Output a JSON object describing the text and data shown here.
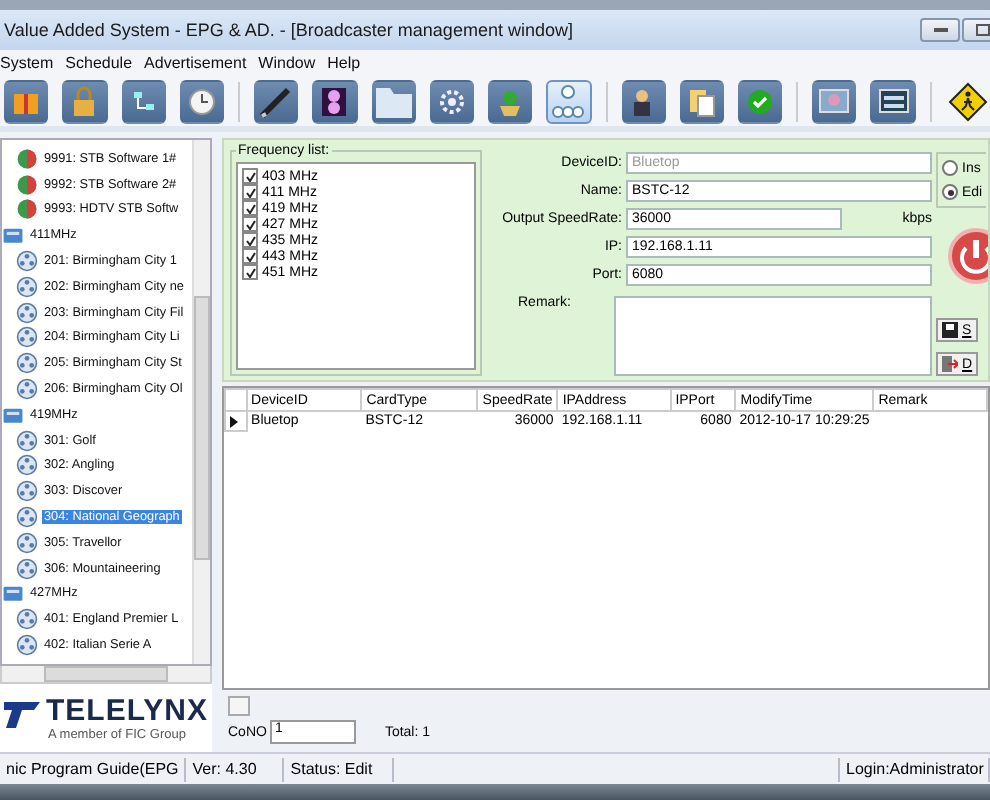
{
  "window": {
    "title": "Value Added System - EPG & AD. - [Broadcaster management window]"
  },
  "menu": [
    "System",
    "Schedule",
    "Advertisement",
    "Window",
    "Help"
  ],
  "toolbar": [
    {
      "selected": false
    },
    {
      "selected": false
    },
    {
      "selected": false
    },
    {
      "selected": false
    },
    {
      "selected": false
    },
    {
      "selected": false
    },
    {
      "selected": false
    },
    {
      "selected": false
    },
    {
      "selected": false
    },
    {
      "selected": true
    },
    {
      "selected": false
    },
    {
      "selected": false
    },
    {
      "selected": false
    },
    {
      "selected": false
    },
    {
      "selected": false
    },
    {
      "selected": false
    }
  ],
  "tree": [
    {
      "kind": "software",
      "label": "9991: STB Software 1#",
      "selected": false
    },
    {
      "kind": "software",
      "label": "9992: STB Software 2#",
      "selected": false
    },
    {
      "kind": "software",
      "label": "9993: HDTV STB Softw",
      "selected": false
    },
    {
      "kind": "frequency",
      "label": "411MHz",
      "selected": false,
      "children": [
        {
          "kind": "channel",
          "label": "201: Birmingham City 1",
          "selected": false
        },
        {
          "kind": "channel",
          "label": "202: Birmingham City ne",
          "selected": false
        },
        {
          "kind": "channel",
          "label": "203: Birmingham City Fil",
          "selected": false
        },
        {
          "kind": "channel",
          "label": "204: Birmingham City Li",
          "selected": false
        },
        {
          "kind": "channel",
          "label": "205: Birmingham City St",
          "selected": false
        },
        {
          "kind": "channel",
          "label": "206: Birmingham City Ol",
          "selected": false
        }
      ]
    },
    {
      "kind": "frequency",
      "label": "419MHz",
      "selected": false,
      "children": [
        {
          "kind": "channel",
          "label": "301: Golf",
          "selected": false
        },
        {
          "kind": "channel",
          "label": "302: Angling",
          "selected": false
        },
        {
          "kind": "channel",
          "label": "303: Discover",
          "selected": false
        },
        {
          "kind": "channel",
          "label": "304: National Geograph",
          "selected": true
        },
        {
          "kind": "channel",
          "label": "305: Travellor",
          "selected": false
        },
        {
          "kind": "channel",
          "label": "306: Mountaineering",
          "selected": false
        }
      ]
    },
    {
      "kind": "frequency",
      "label": "427MHz",
      "selected": false,
      "children": [
        {
          "kind": "channel",
          "label": "401: England Premier L",
          "selected": false
        },
        {
          "kind": "channel",
          "label": "402: Italian Serie A",
          "selected": false
        }
      ]
    }
  ],
  "logo": {
    "name": "TELELYNX",
    "tagline": "A member of FIC Group"
  },
  "frequency_list": {
    "title": "Frequency list:",
    "items": [
      {
        "label": "403 MHz",
        "checked": true
      },
      {
        "label": "411 MHz",
        "checked": true
      },
      {
        "label": "419 MHz",
        "checked": true
      },
      {
        "label": "427 MHz",
        "checked": true
      },
      {
        "label": "435 MHz",
        "checked": true
      },
      {
        "label": "443 MHz",
        "checked": true
      },
      {
        "label": "451 MHz",
        "checked": true
      }
    ]
  },
  "device_form": {
    "fields": [
      {
        "label": "DeviceID:",
        "value": "Bluetop",
        "disabled": true
      },
      {
        "label": "Name:",
        "value": "BSTC-12",
        "disabled": false
      },
      {
        "label": "Output SpeedRate:",
        "value": "36000",
        "unit": "kbps",
        "disabled": false
      },
      {
        "label": "IP:",
        "value": "192.168.1.11",
        "disabled": false
      },
      {
        "label": "Port:",
        "value": "6080",
        "disabled": false
      }
    ],
    "remark": {
      "label": "Remark:"
    }
  },
  "mode_options": [
    {
      "label": "Ins",
      "selected": false
    },
    {
      "label": "Edi",
      "selected": true
    }
  ],
  "actions": [
    {
      "kind": "save",
      "label": "S"
    },
    {
      "kind": "delete",
      "label": "D"
    }
  ],
  "table": {
    "columns": [
      "DeviceID",
      "CardType",
      "SpeedRate",
      "IPAddress",
      "IPPort",
      "ModifyTime",
      "Remark"
    ],
    "rows": [
      {
        "selected": true,
        "cells": [
          "Bluetop",
          "BSTC-12",
          "36000",
          "192.168.1.11",
          "6080",
          "2012-10-17 10:29:25"
        ]
      }
    ]
  },
  "record_bar": {
    "label": "CoNO",
    "value": "1",
    "total": "Total: 1"
  },
  "status_bar": [
    "nic Program Guide(EPG",
    "Ver: 4.30",
    "Status: Edit",
    "Login:Administrator"
  ]
}
